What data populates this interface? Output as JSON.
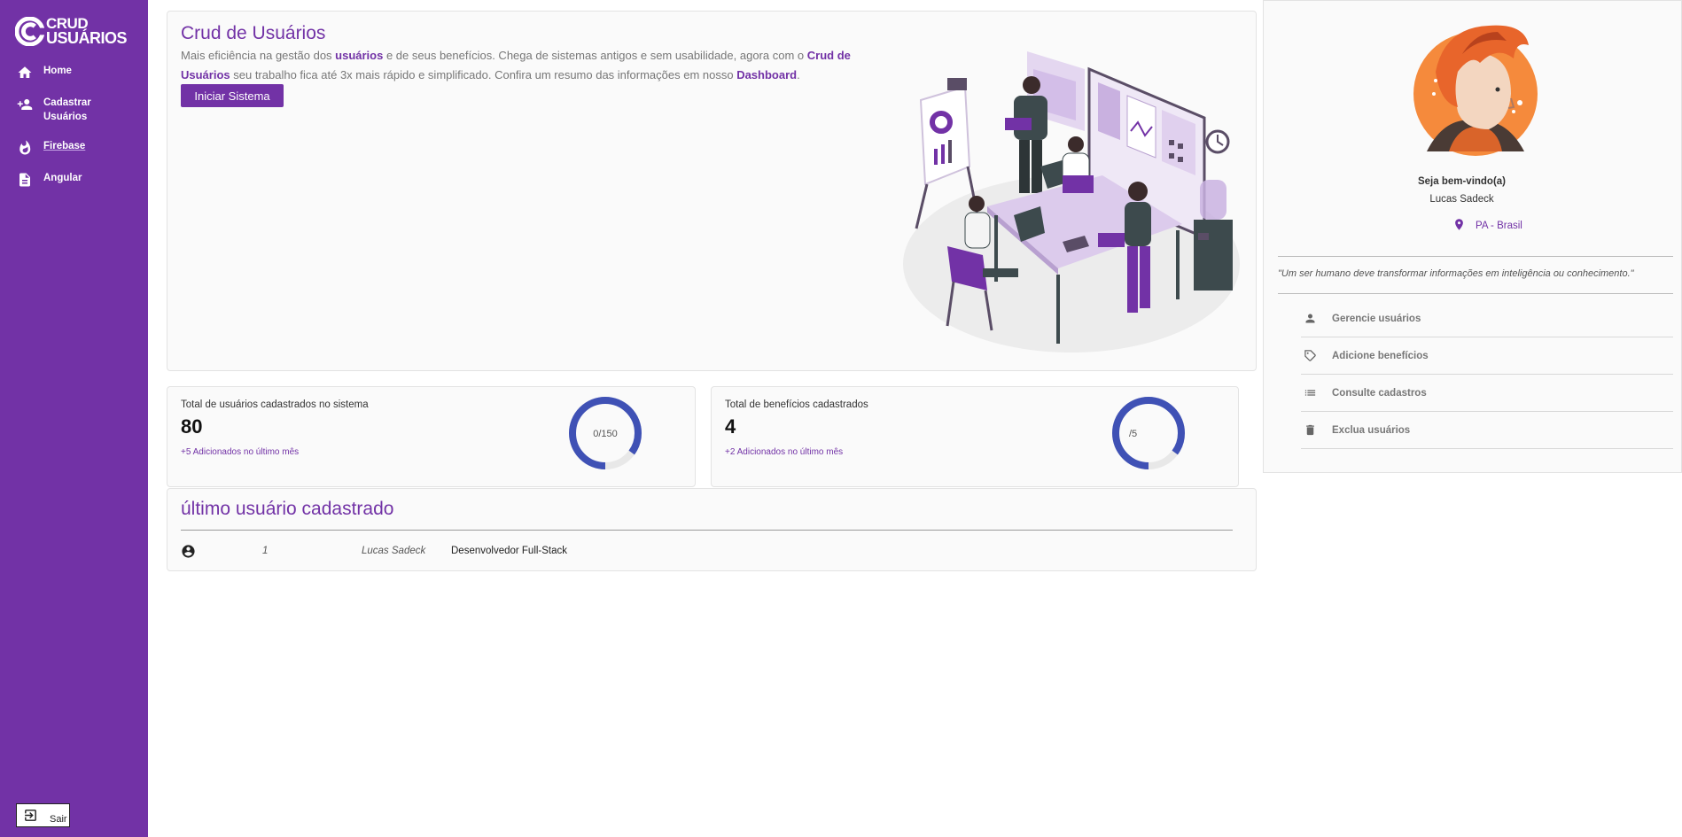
{
  "brand": {
    "line1": "CRUD",
    "line2": "USUÁRIOS",
    "color": "#7232a6"
  },
  "sidebar": {
    "items": [
      {
        "label": "Home",
        "icon": "home-icon"
      },
      {
        "label": "Cadastrar Usuários",
        "icon": "person-add-icon"
      },
      {
        "label": "Firebase",
        "icon": "fire-icon"
      },
      {
        "label": "Angular",
        "icon": "document-icon"
      }
    ],
    "logout_label": "Sair"
  },
  "hero": {
    "title": "Crud de Usuários",
    "text_1": "Mais eficiência na gestão dos ",
    "text_link_1": "usuários",
    "text_2": " e de seus benefícios. Chega de sistemas antigos e sem usabilidade, agora com o ",
    "text_link_2": "Crud de Usuários",
    "text_3": " seu trabalho fica até 3x mais rápido e simplificado. Confira um resumo das informações em nosso ",
    "text_link_3": "Dashboard",
    "text_4": ".",
    "button_label": "Iniciar Sistema"
  },
  "stats": [
    {
      "label": "Total de usuários cadastrados no sistema",
      "value": "80",
      "sub": "+5 Adicionados no último mês",
      "donut_text": "0/150",
      "donut_fraction": 0.85
    },
    {
      "label": "Total de benefícios cadastrados",
      "value": "4",
      "sub": "+2 Adicionados no último mês",
      "donut_text": "/5",
      "donut_fraction": 0.85
    }
  ],
  "last_user": {
    "title": "último usuário cadastrado",
    "id": "1",
    "name": "Lucas Sadeck",
    "role": "Desenvolvedor Full-Stack"
  },
  "profile": {
    "welcome": "Seja bem-vindo(a)",
    "name": "Lucas Sadeck",
    "location": "PA - Brasil",
    "quote": "\"Um ser humano deve transformar informações em inteligência ou conhecimento.\"",
    "menu": [
      {
        "label": "Gerencie usuários",
        "icon": "person-icon"
      },
      {
        "label": "Adicione benefícios",
        "icon": "tag-icon"
      },
      {
        "label": "Consulte cadastros",
        "icon": "list-icon"
      },
      {
        "label": "Exclua usuários",
        "icon": "trash-icon"
      }
    ]
  },
  "colors": {
    "donut": "#3f51b5",
    "sidebar": "#7232a6",
    "avatar_bg": "#f58a3c"
  }
}
